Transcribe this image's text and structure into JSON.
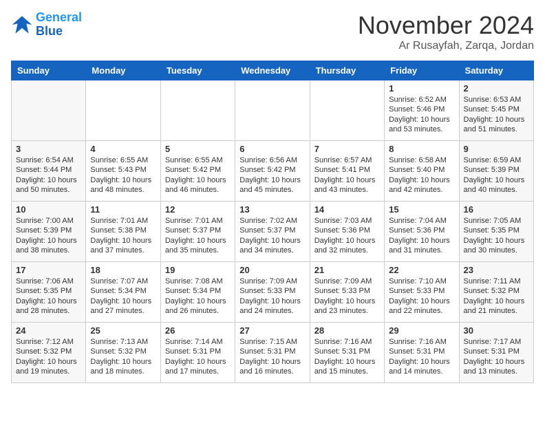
{
  "header": {
    "logo_line1": "General",
    "logo_line2": "Blue",
    "month": "November 2024",
    "location": "Ar Rusayfah, Zarqa, Jordan"
  },
  "weekdays": [
    "Sunday",
    "Monday",
    "Tuesday",
    "Wednesday",
    "Thursday",
    "Friday",
    "Saturday"
  ],
  "weeks": [
    [
      {
        "day": "",
        "info": ""
      },
      {
        "day": "",
        "info": ""
      },
      {
        "day": "",
        "info": ""
      },
      {
        "day": "",
        "info": ""
      },
      {
        "day": "",
        "info": ""
      },
      {
        "day": "1",
        "info": "Sunrise: 6:52 AM\nSunset: 5:46 PM\nDaylight: 10 hours\nand 53 minutes."
      },
      {
        "day": "2",
        "info": "Sunrise: 6:53 AM\nSunset: 5:45 PM\nDaylight: 10 hours\nand 51 minutes."
      }
    ],
    [
      {
        "day": "3",
        "info": "Sunrise: 6:54 AM\nSunset: 5:44 PM\nDaylight: 10 hours\nand 50 minutes."
      },
      {
        "day": "4",
        "info": "Sunrise: 6:55 AM\nSunset: 5:43 PM\nDaylight: 10 hours\nand 48 minutes."
      },
      {
        "day": "5",
        "info": "Sunrise: 6:55 AM\nSunset: 5:42 PM\nDaylight: 10 hours\nand 46 minutes."
      },
      {
        "day": "6",
        "info": "Sunrise: 6:56 AM\nSunset: 5:42 PM\nDaylight: 10 hours\nand 45 minutes."
      },
      {
        "day": "7",
        "info": "Sunrise: 6:57 AM\nSunset: 5:41 PM\nDaylight: 10 hours\nand 43 minutes."
      },
      {
        "day": "8",
        "info": "Sunrise: 6:58 AM\nSunset: 5:40 PM\nDaylight: 10 hours\nand 42 minutes."
      },
      {
        "day": "9",
        "info": "Sunrise: 6:59 AM\nSunset: 5:39 PM\nDaylight: 10 hours\nand 40 minutes."
      }
    ],
    [
      {
        "day": "10",
        "info": "Sunrise: 7:00 AM\nSunset: 5:39 PM\nDaylight: 10 hours\nand 38 minutes."
      },
      {
        "day": "11",
        "info": "Sunrise: 7:01 AM\nSunset: 5:38 PM\nDaylight: 10 hours\nand 37 minutes."
      },
      {
        "day": "12",
        "info": "Sunrise: 7:01 AM\nSunset: 5:37 PM\nDaylight: 10 hours\nand 35 minutes."
      },
      {
        "day": "13",
        "info": "Sunrise: 7:02 AM\nSunset: 5:37 PM\nDaylight: 10 hours\nand 34 minutes."
      },
      {
        "day": "14",
        "info": "Sunrise: 7:03 AM\nSunset: 5:36 PM\nDaylight: 10 hours\nand 32 minutes."
      },
      {
        "day": "15",
        "info": "Sunrise: 7:04 AM\nSunset: 5:36 PM\nDaylight: 10 hours\nand 31 minutes."
      },
      {
        "day": "16",
        "info": "Sunrise: 7:05 AM\nSunset: 5:35 PM\nDaylight: 10 hours\nand 30 minutes."
      }
    ],
    [
      {
        "day": "17",
        "info": "Sunrise: 7:06 AM\nSunset: 5:35 PM\nDaylight: 10 hours\nand 28 minutes."
      },
      {
        "day": "18",
        "info": "Sunrise: 7:07 AM\nSunset: 5:34 PM\nDaylight: 10 hours\nand 27 minutes."
      },
      {
        "day": "19",
        "info": "Sunrise: 7:08 AM\nSunset: 5:34 PM\nDaylight: 10 hours\nand 26 minutes."
      },
      {
        "day": "20",
        "info": "Sunrise: 7:09 AM\nSunset: 5:33 PM\nDaylight: 10 hours\nand 24 minutes."
      },
      {
        "day": "21",
        "info": "Sunrise: 7:09 AM\nSunset: 5:33 PM\nDaylight: 10 hours\nand 23 minutes."
      },
      {
        "day": "22",
        "info": "Sunrise: 7:10 AM\nSunset: 5:33 PM\nDaylight: 10 hours\nand 22 minutes."
      },
      {
        "day": "23",
        "info": "Sunrise: 7:11 AM\nSunset: 5:32 PM\nDaylight: 10 hours\nand 21 minutes."
      }
    ],
    [
      {
        "day": "24",
        "info": "Sunrise: 7:12 AM\nSunset: 5:32 PM\nDaylight: 10 hours\nand 19 minutes."
      },
      {
        "day": "25",
        "info": "Sunrise: 7:13 AM\nSunset: 5:32 PM\nDaylight: 10 hours\nand 18 minutes."
      },
      {
        "day": "26",
        "info": "Sunrise: 7:14 AM\nSunset: 5:31 PM\nDaylight: 10 hours\nand 17 minutes."
      },
      {
        "day": "27",
        "info": "Sunrise: 7:15 AM\nSunset: 5:31 PM\nDaylight: 10 hours\nand 16 minutes."
      },
      {
        "day": "28",
        "info": "Sunrise: 7:16 AM\nSunset: 5:31 PM\nDaylight: 10 hours\nand 15 minutes."
      },
      {
        "day": "29",
        "info": "Sunrise: 7:16 AM\nSunset: 5:31 PM\nDaylight: 10 hours\nand 14 minutes."
      },
      {
        "day": "30",
        "info": "Sunrise: 7:17 AM\nSunset: 5:31 PM\nDaylight: 10 hours\nand 13 minutes."
      }
    ]
  ]
}
